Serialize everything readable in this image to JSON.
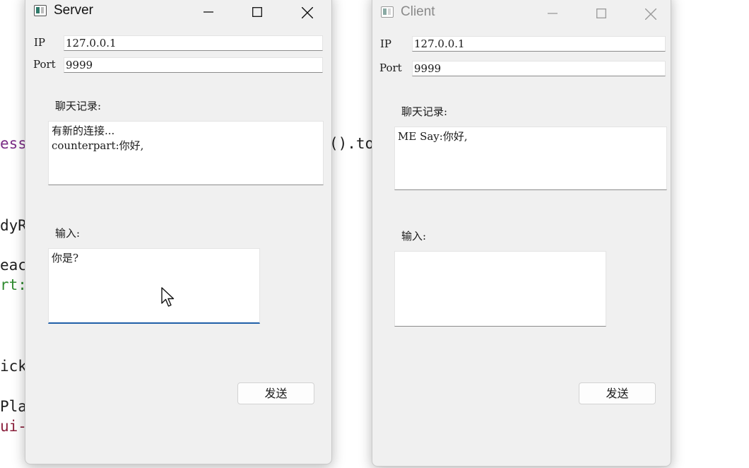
{
  "background_code": {
    "line1": "ess",
    "line1_right": "().to",
    "line2": "dyR",
    "line3": "eac",
    "line4": "rt:",
    "line5": "ick",
    "line6": "Pla",
    "line7": "ui-"
  },
  "server": {
    "title": "Server",
    "ip_label": "IP",
    "ip_value": "127.0.0.1",
    "port_label": "Port",
    "port_value": "9999",
    "history_label": "聊天记录:",
    "history_lines": [
      "有新的连接...",
      "counterpart:你好,"
    ],
    "input_label": "输入:",
    "input_value": "你是?",
    "send_label": "发送"
  },
  "client": {
    "title": "Client",
    "ip_label": "IP",
    "ip_value": "127.0.0.1",
    "port_label": "Port",
    "port_value": "9999",
    "history_label": "聊天记录:",
    "history_lines": [
      "ME Say:你好,"
    ],
    "input_label": "输入:",
    "input_value": "",
    "send_label": "发送"
  },
  "icons": {
    "app": "qt-window-icon",
    "minimize": "minimize-icon",
    "maximize": "maximize-icon",
    "close": "close-icon",
    "cursor": "mouse-pointer-icon"
  }
}
